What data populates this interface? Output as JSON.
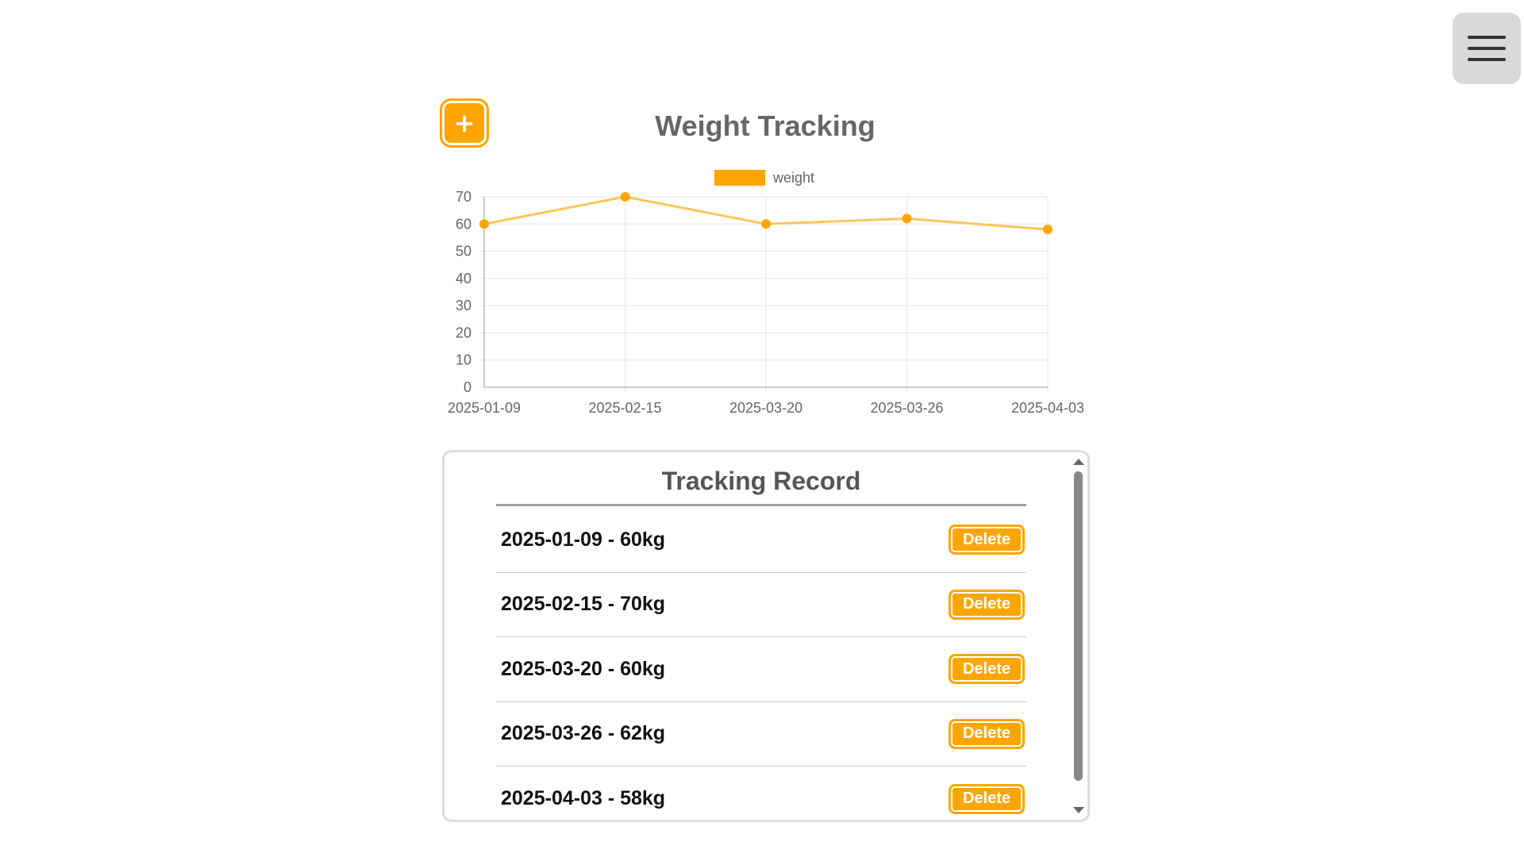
{
  "header": {
    "menu_icon": "hamburger-menu-icon",
    "add_icon": "plus-icon",
    "add_label": "+"
  },
  "colors": {
    "accent": "#FFA500",
    "line": "#FFC55A",
    "grid": "#E5E5E5",
    "text": "#666666"
  },
  "chart_data": {
    "type": "line",
    "title": "Weight Tracking",
    "legend": {
      "labels": [
        "weight"
      ],
      "placement": "top-center"
    },
    "x": [
      "2025-01-09",
      "2025-02-15",
      "2025-03-20",
      "2025-03-26",
      "2025-04-03"
    ],
    "series": [
      {
        "name": "weight",
        "values": [
          60,
          70,
          60,
          62,
          58
        ]
      }
    ],
    "ylim": [
      0,
      70
    ],
    "yticks": [
      0,
      10,
      20,
      30,
      40,
      50,
      60,
      70
    ],
    "grid": true
  },
  "records": {
    "title": "Tracking Record",
    "items": [
      {
        "text": "2025-01-09 - 60kg",
        "delete_label": "Delete"
      },
      {
        "text": "2025-02-15 - 70kg",
        "delete_label": "Delete"
      },
      {
        "text": "2025-03-20 - 60kg",
        "delete_label": "Delete"
      },
      {
        "text": "2025-03-26 - 62kg",
        "delete_label": "Delete"
      },
      {
        "text": "2025-04-03 - 58kg",
        "delete_label": "Delete"
      }
    ]
  }
}
